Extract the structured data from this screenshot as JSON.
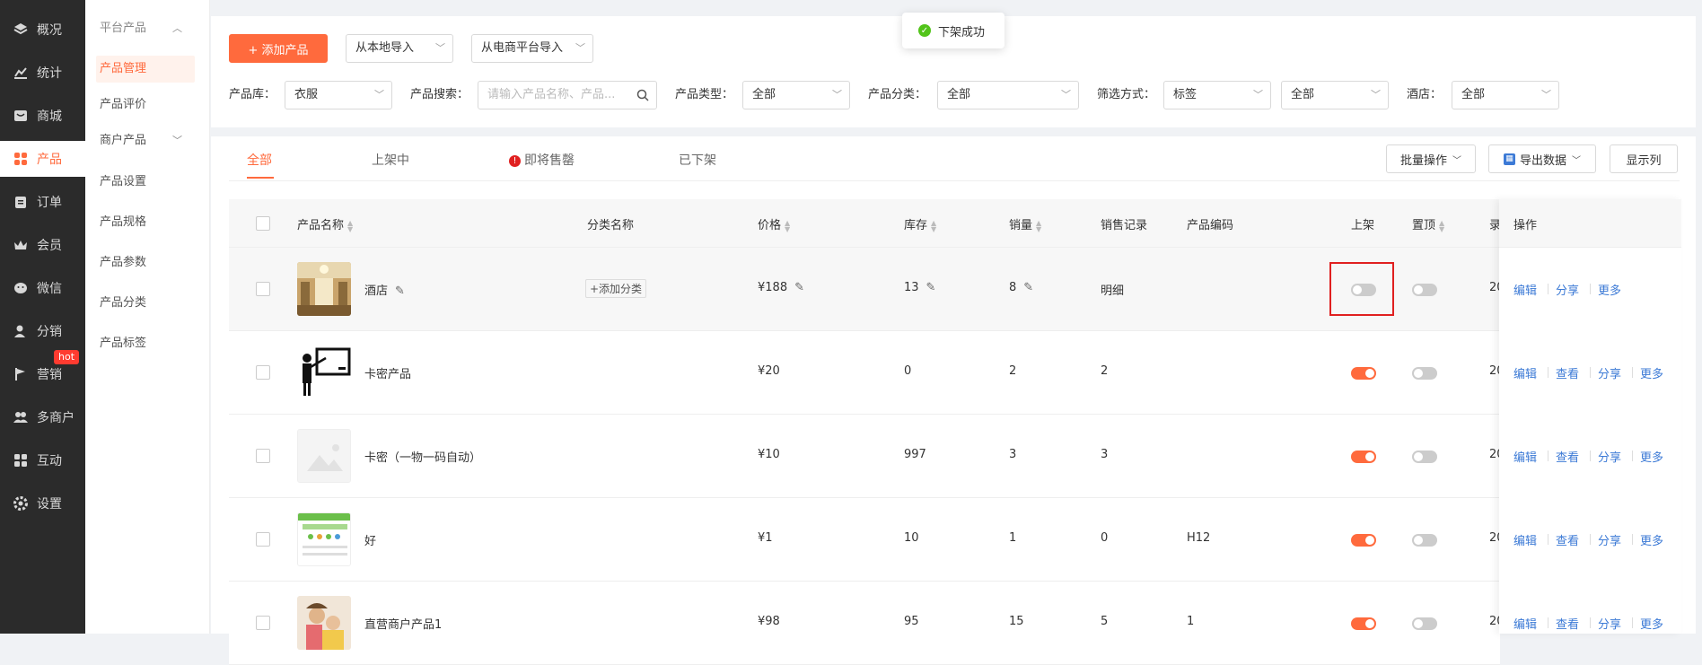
{
  "nav": {
    "items": [
      {
        "label": "概况",
        "icon": "layers-icon"
      },
      {
        "label": "统计",
        "icon": "chart-icon"
      },
      {
        "label": "商城",
        "icon": "store-icon"
      },
      {
        "label": "产品",
        "icon": "grid-icon"
      },
      {
        "label": "订单",
        "icon": "clipboard-icon"
      },
      {
        "label": "会员",
        "icon": "crown-icon"
      },
      {
        "label": "微信",
        "icon": "wechat-icon"
      },
      {
        "label": "分销",
        "icon": "user-share-icon"
      },
      {
        "label": "营销",
        "icon": "flag-icon"
      },
      {
        "label": "多商户",
        "icon": "users-icon"
      },
      {
        "label": "互动",
        "icon": "apps-icon"
      },
      {
        "label": "设置",
        "icon": "gear-icon"
      }
    ],
    "hot_badge": "hot"
  },
  "subnav": {
    "group1": "平台产品",
    "items1": [
      "产品管理",
      "产品评价"
    ],
    "group2": "商户产品",
    "items2": [
      "产品设置",
      "产品规格",
      "产品参数",
      "产品分类",
      "产品标签"
    ]
  },
  "toast": {
    "text": "下架成功"
  },
  "toolbar": {
    "add_label": "+ 添加产品",
    "import_local": "从本地导入",
    "import_ecom": "从电商平台导入"
  },
  "filters": {
    "library_label": "产品库：",
    "library_value": "衣服",
    "search_label": "产品搜索：",
    "search_placeholder": "请输入产品名称、产品...",
    "type_label": "产品类型：",
    "type_value": "全部",
    "category_label": "产品分类：",
    "category_value": "全部",
    "filter_label": "筛选方式：",
    "filter_value": "标签",
    "filter_value2": "全部",
    "hotel_label": "酒店：",
    "hotel_value": "全部"
  },
  "tabs": [
    "全部",
    "上架中",
    "即将售罄",
    "已下架"
  ],
  "actions": {
    "batch": "批量操作",
    "export": "导出数据",
    "columns": "显示列"
  },
  "table": {
    "headers": {
      "name": "产品名称",
      "category": "分类名称",
      "price": "价格",
      "stock": "库存",
      "sales": "销量",
      "sales_record": "销售记录",
      "code": "产品编码",
      "listed": "上架",
      "pin": "置顶",
      "created": "录",
      "ops": "操作"
    },
    "add_category": "+添加分类",
    "ops_labels": {
      "edit": "编辑",
      "view": "查看",
      "share": "分享",
      "more": "更多"
    },
    "rows": [
      {
        "name": "酒店",
        "category": "",
        "price": "¥188",
        "stock": "13",
        "sales": "8",
        "record": "明细",
        "code": "",
        "listed": false,
        "pinned": false,
        "created": "20",
        "thumb": "hotel"
      },
      {
        "name": "卡密产品",
        "category": "",
        "price": "¥20",
        "stock": "0",
        "sales": "2",
        "record": "2",
        "code": "",
        "listed": true,
        "pinned": false,
        "created": "20",
        "thumb": "teacher"
      },
      {
        "name": "卡密（一物一码自动）",
        "category": "",
        "price": "¥10",
        "stock": "997",
        "sales": "3",
        "record": "3",
        "code": "",
        "listed": true,
        "pinned": false,
        "created": "20",
        "thumb": "placeholder"
      },
      {
        "name": "好",
        "category": "",
        "price": "¥1",
        "stock": "10",
        "sales": "1",
        "record": "0",
        "code": "H12",
        "listed": true,
        "pinned": false,
        "created": "20",
        "thumb": "app"
      },
      {
        "name": "直营商户产品1",
        "category": "",
        "price": "¥98",
        "stock": "95",
        "sales": "15",
        "record": "5",
        "code": "1",
        "listed": true,
        "pinned": false,
        "created": "20",
        "thumb": "kids"
      }
    ]
  },
  "colors": {
    "accent": "#ff6a3d",
    "link": "#3c7ad6",
    "nav_bg": "#2b2b2b",
    "highlight": "#e02020"
  }
}
